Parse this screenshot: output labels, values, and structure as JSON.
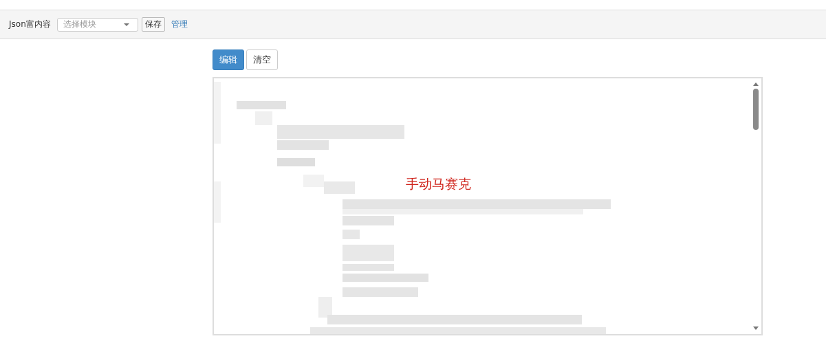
{
  "toolbar": {
    "label": "Json富内容",
    "module_select": {
      "placeholder": "选择模块"
    },
    "save_button": "保存",
    "manage_link": "管理"
  },
  "editor_actions": [
    {
      "label": "编辑",
      "kind": "primary"
    },
    {
      "label": "清空",
      "kind": "default"
    }
  ],
  "editor": {
    "annotation": "手动马赛克"
  }
}
